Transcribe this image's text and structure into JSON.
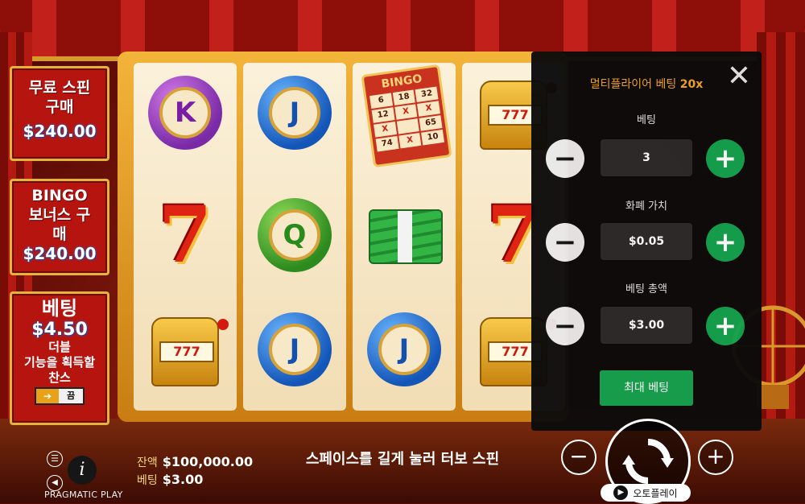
{
  "left_panel": {
    "free_spin": {
      "label": "무료 스핀 구매",
      "price": "$240.00"
    },
    "bingo_bonus": {
      "label": "BINGO 보너스 구매",
      "price": "$240.00"
    },
    "ante_bet": {
      "title": "베팅",
      "amount": "$4.50",
      "text1": "더블",
      "text2": "기능을 획득할",
      "text3": "찬스",
      "toggle_label": "끔"
    }
  },
  "reels": {
    "r1": [
      "K",
      "7",
      "777"
    ],
    "r2": [
      "J",
      "Q",
      "J"
    ],
    "r3": [
      "BINGO",
      "cash",
      "J"
    ],
    "r4": [
      "777",
      "7",
      "777"
    ],
    "bingo_card": {
      "header": "BINGO",
      "cells": [
        "6",
        "18",
        "32",
        "12",
        "X",
        "X",
        "X",
        "",
        "65",
        "74",
        "X",
        "10"
      ]
    }
  },
  "bet_panel": {
    "title": "멀티플라이어 베팅",
    "multiplier": "20x",
    "bet_level": {
      "label": "베팅",
      "value": "3"
    },
    "coin_value": {
      "label": "화폐 가치",
      "value": "$0.05"
    },
    "total_bet": {
      "label": "베팅 총액",
      "value": "$3.00"
    },
    "max_bet": "최대 베팅",
    "close": "✕",
    "minus": "−",
    "plus": "+"
  },
  "bottom": {
    "balance_label": "잔액",
    "balance": "$100,000.00",
    "bet_label": "베팅",
    "bet": "$3.00",
    "message": "스페이스를 길게 눌러 터보 스핀",
    "autoplay": "오토플레이",
    "brand": "PRAGMATIC PLAY",
    "minus": "−",
    "plus": "+"
  },
  "icons": {
    "menu": "menu-icon",
    "info": "info-icon",
    "sound": "sound-icon",
    "spin": "spin-arrows-icon"
  },
  "colors": {
    "accent_green": "#12a24e",
    "accent_gold": "#f2a51c",
    "panel_red": "#b6150f"
  }
}
